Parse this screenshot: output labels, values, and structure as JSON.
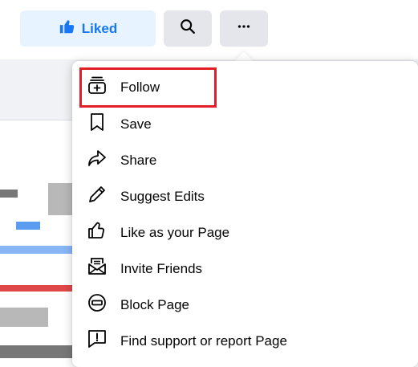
{
  "actions": {
    "liked_label": "Liked",
    "liked_icon": "thumbs-up-icon",
    "search_icon": "search-icon",
    "more_icon": "more-dots-icon"
  },
  "menu": {
    "items": [
      {
        "label": "Follow",
        "icon": "follow-icon",
        "highlighted": true
      },
      {
        "label": "Save",
        "icon": "bookmark-icon"
      },
      {
        "label": "Share",
        "icon": "share-icon"
      },
      {
        "label": "Suggest Edits",
        "icon": "pencil-icon"
      },
      {
        "label": "Like as your Page",
        "icon": "thumbs-up-outline-icon"
      },
      {
        "label": "Invite Friends",
        "icon": "invite-envelope-icon"
      },
      {
        "label": "Block Page",
        "icon": "block-icon"
      },
      {
        "label": "Find support or report Page",
        "icon": "report-flag-icon"
      }
    ]
  },
  "colors": {
    "accent": "#1877f2",
    "liked_bg": "#e7f3ff",
    "button_bg": "#e4e6eb",
    "highlight": "#e41e26"
  }
}
